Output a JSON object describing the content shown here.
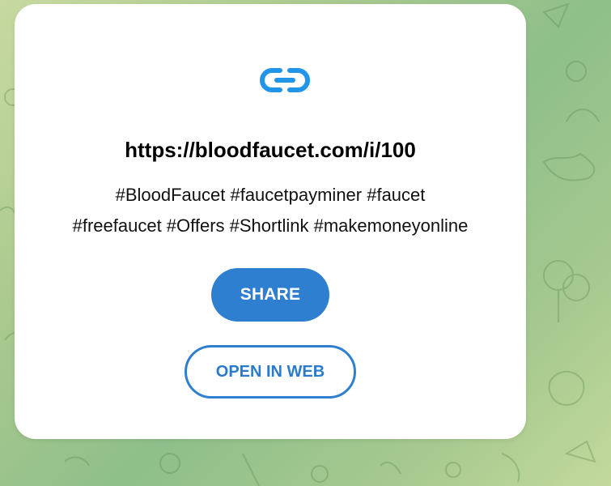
{
  "card": {
    "icon": "link-icon",
    "url": "https://bloodfaucet.com/i/100",
    "tags_line1": "#BloodFaucet #faucetpayminer #faucet",
    "tags_line2": "#freefaucet #Offers #Shortlink #makemoneyonline",
    "share_label": "SHARE",
    "open_label": "OPEN IN WEB"
  },
  "colors": {
    "accent": "#2f7fd0",
    "background": "#a9c98e"
  }
}
